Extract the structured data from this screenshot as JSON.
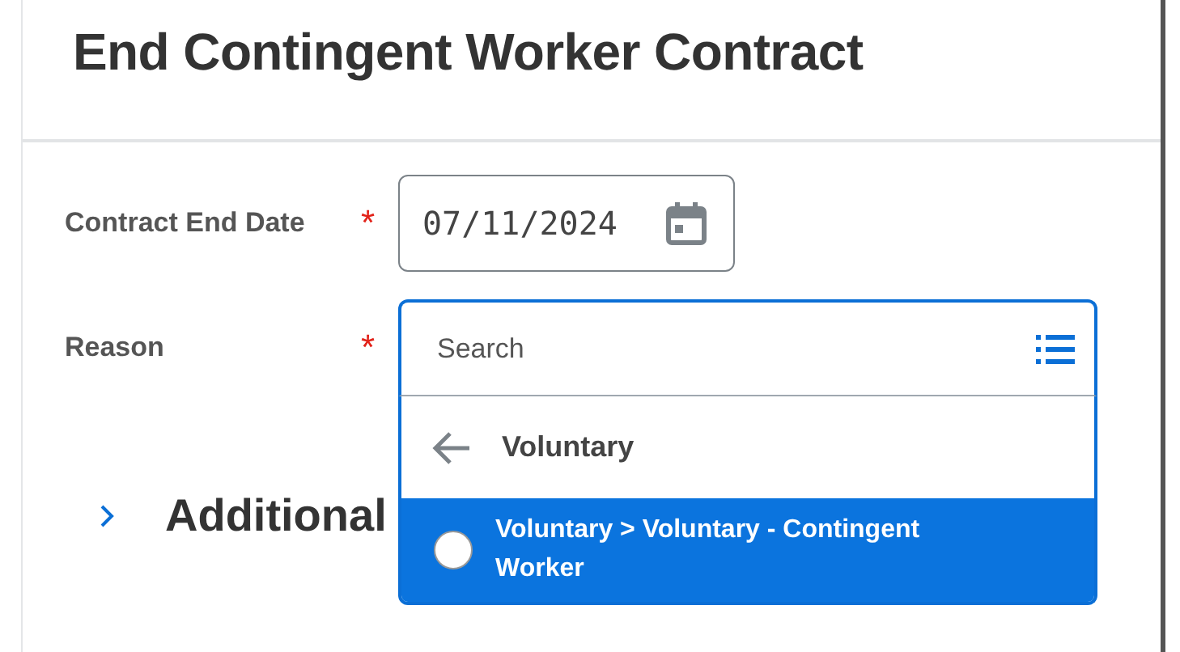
{
  "title": "End Contingent Worker Contract",
  "fields": [
    {
      "label": "Contract End Date",
      "required_mark": "*",
      "value": "07/11/2024"
    },
    {
      "label": "Reason",
      "required_mark": "*",
      "placeholder": "Search"
    }
  ],
  "reason_menu": {
    "breadcrumb": "Voluntary",
    "options": [
      {
        "label": "Voluntary > Voluntary - Contingent Worker",
        "selected": true,
        "checked": false
      }
    ]
  },
  "section": {
    "title": "Additional",
    "expanded": false
  }
}
